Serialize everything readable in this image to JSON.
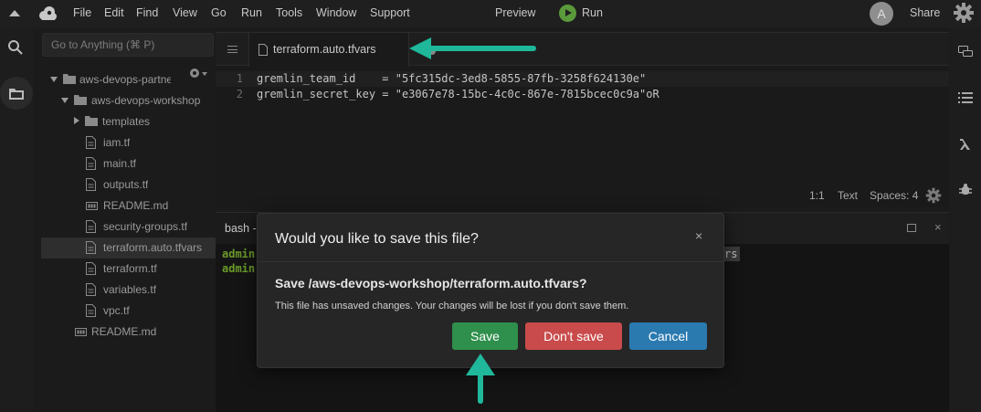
{
  "menu": {
    "items": [
      "File",
      "Edit",
      "Find",
      "View",
      "Go",
      "Run",
      "Tools",
      "Window",
      "Support"
    ],
    "preview": "Preview",
    "run": "Run",
    "avatar_initial": "A",
    "share": "Share"
  },
  "left_strip": {
    "icons": [
      "search-icon",
      "folder-icon"
    ]
  },
  "tree": {
    "goto_placeholder": "Go to Anything (⌘ P)",
    "rows": [
      {
        "label": "aws-devops-partne",
        "type": "folder-open"
      },
      {
        "label": "aws-devops-workshop",
        "type": "folder-open"
      },
      {
        "label": "templates",
        "type": "folder-closed"
      },
      {
        "label": "iam.tf",
        "type": "file"
      },
      {
        "label": "main.tf",
        "type": "file"
      },
      {
        "label": "outputs.tf",
        "type": "file"
      },
      {
        "label": "README.md",
        "type": "md"
      },
      {
        "label": "security-groups.tf",
        "type": "file"
      },
      {
        "label": "terraform.auto.tfvars",
        "type": "file",
        "selected": true
      },
      {
        "label": "terraform.tf",
        "type": "file"
      },
      {
        "label": "variables.tf",
        "type": "file"
      },
      {
        "label": "vpc.tf",
        "type": "file"
      },
      {
        "label": "README.md",
        "type": "md"
      }
    ]
  },
  "editor": {
    "tab_label": "terraform.auto.tfvars",
    "lines": [
      {
        "num": "1",
        "text": "gremlin_team_id    = \"5fc315dc-3ed8-5855-87fb-3258f624130e\""
      },
      {
        "num": "2",
        "text": "gremlin_secret_key = \"e3067e78-15bc-4c0c-867e-7815bcec0c9a\"oR"
      }
    ],
    "status": {
      "position": "1:1",
      "mode": "Text",
      "spaces": "Spaces: 4"
    }
  },
  "terminal": {
    "tab_label": "bash -",
    "lines": [
      "admin",
      "admin"
    ],
    "highlight_fragment": "rs"
  },
  "right_strip": {
    "icons": [
      "chat-icon",
      "outline-icon",
      "lambda-icon",
      "debug-icon"
    ]
  },
  "dialog": {
    "title": "Would you like to save this file?",
    "close": "×",
    "question": "Save /aws-devops-workshop/terraform.auto.tfvars?",
    "message": "This file has unsaved changes. Your changes will be lost if you don't save them.",
    "save": "Save",
    "dont_save": "Don't save",
    "cancel": "Cancel"
  },
  "colors": {
    "accent_arrow": "#1fb89a",
    "save": "#2f8f4c",
    "dont_save": "#c94b4b",
    "cancel": "#2a7ab0"
  }
}
